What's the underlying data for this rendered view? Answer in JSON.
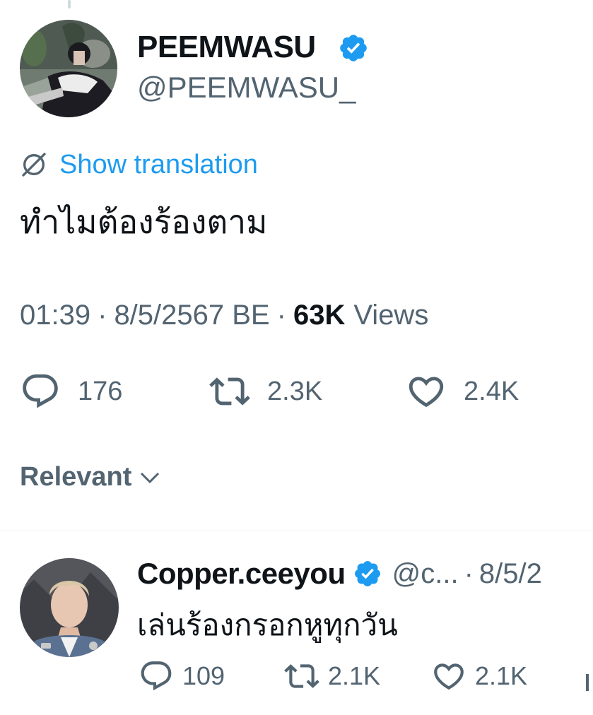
{
  "main_tweet": {
    "author_name": "PEEMWASU",
    "author_handle": "@PEEMWASU_",
    "show_translation_label": "Show translation",
    "text": "ทำไมต้องร้องตาม",
    "time": "01:39",
    "date": "8/5/2567 BE",
    "views_count": "63K",
    "views_label": "Views",
    "actions": {
      "replies": "176",
      "reposts": "2.3K",
      "likes": "2.4K"
    }
  },
  "sort": {
    "label": "Relevant"
  },
  "reply": {
    "author_name": "Copper.ceeyou",
    "author_handle": "@c...",
    "date": "8/5/2",
    "text": "เล่นร้องกรอกหูทุกวัน",
    "actions": {
      "replies": "109",
      "reposts": "2.1K",
      "likes": "2.1K"
    }
  },
  "separator": "·",
  "colors": {
    "accent": "#1d9bf0",
    "text_primary": "#0f1419",
    "text_secondary": "#536471",
    "divider": "#eff3f4"
  },
  "icons": {
    "verified": "verified-badge-icon",
    "translate": "translate-globe-icon",
    "reply": "reply-bubble-icon",
    "repost": "repost-icon",
    "like": "heart-icon",
    "chevron": "chevron-down-icon",
    "analytics": "analytics-icon"
  }
}
